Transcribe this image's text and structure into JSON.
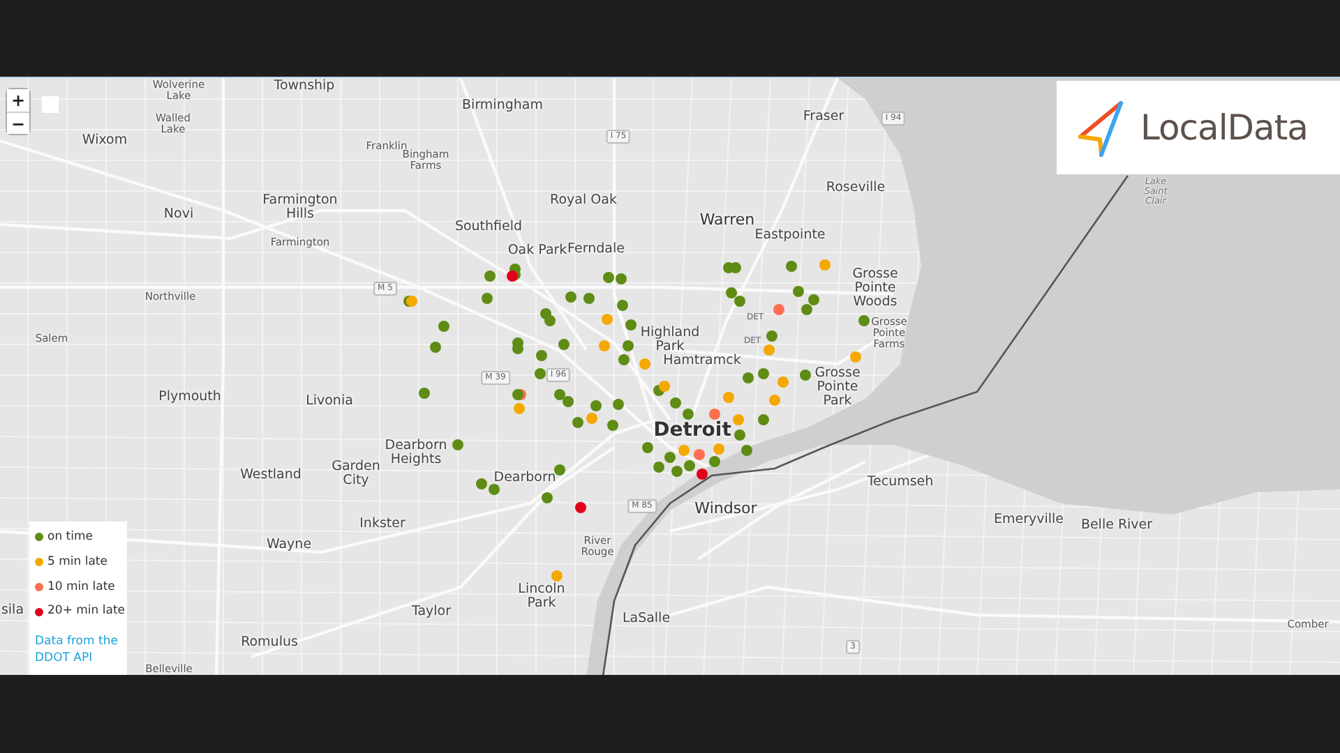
{
  "map_controls": {
    "zoom_in": "+",
    "zoom_out": "−"
  },
  "logo": {
    "text": "LocalData"
  },
  "place_labels": [
    {
      "text": "Township",
      "kind": "city"
    },
    {
      "text": "Wolverine Lake",
      "kind": "town"
    },
    {
      "text": "Walled Lake",
      "kind": "town"
    },
    {
      "text": "Wixom",
      "kind": "city"
    },
    {
      "text": "Birmingham",
      "kind": "city"
    },
    {
      "text": "Franklin",
      "kind": "town"
    },
    {
      "text": "Bingham Farms",
      "kind": "town"
    },
    {
      "text": "Novi",
      "kind": "city"
    },
    {
      "text": "Farmington Hills",
      "kind": "city"
    },
    {
      "text": "Farmington",
      "kind": "town"
    },
    {
      "text": "Royal Oak",
      "kind": "city"
    },
    {
      "text": "Southfield",
      "kind": "city"
    },
    {
      "text": "Oak Park",
      "kind": "city"
    },
    {
      "text": "Ferndale",
      "kind": "city"
    },
    {
      "text": "Northville",
      "kind": "town"
    },
    {
      "text": "Salem",
      "kind": "town"
    },
    {
      "text": "Highland Park",
      "kind": "city"
    },
    {
      "text": "Fraser",
      "kind": "city"
    },
    {
      "text": "Roseville",
      "kind": "city"
    },
    {
      "text": "Warren",
      "kind": "major"
    },
    {
      "text": "Eastpointe",
      "kind": "city"
    },
    {
      "text": "Grosse Pointe Woods",
      "kind": "city"
    },
    {
      "text": "Grosse Pointe Farms",
      "kind": "town"
    },
    {
      "text": "Hamtramck",
      "kind": "city"
    },
    {
      "text": "Grosse Pointe Park",
      "kind": "city"
    },
    {
      "text": "Detroit",
      "kind": "capital"
    },
    {
      "text": "Lake Saint Clair",
      "kind": "water"
    },
    {
      "text": "Plymouth",
      "kind": "city"
    },
    {
      "text": "Livonia",
      "kind": "city"
    },
    {
      "text": "Dearborn Heights",
      "kind": "city"
    },
    {
      "text": "Westland",
      "kind": "city"
    },
    {
      "text": "Garden City",
      "kind": "city"
    },
    {
      "text": "Dearborn",
      "kind": "city"
    },
    {
      "text": "Inkster",
      "kind": "city"
    },
    {
      "text": "Wayne",
      "kind": "city"
    },
    {
      "text": "River Rouge",
      "kind": "town"
    },
    {
      "text": "Lincoln Park",
      "kind": "city"
    },
    {
      "text": "Taylor",
      "kind": "city"
    },
    {
      "text": "LaSalle",
      "kind": "city"
    },
    {
      "text": "Romulus",
      "kind": "city"
    },
    {
      "text": "Belleville",
      "kind": "town"
    },
    {
      "text": "sila",
      "kind": "city"
    },
    {
      "text": "Windsor",
      "kind": "major"
    },
    {
      "text": "Tecumseh",
      "kind": "city"
    },
    {
      "text": "Emeryville",
      "kind": "city"
    },
    {
      "text": "Belle River",
      "kind": "city"
    },
    {
      "text": "Comber",
      "kind": "town"
    }
  ],
  "road_shields": [
    "M 5",
    "I 75",
    "I 94",
    "M 39",
    "I 96",
    "M 85",
    "3",
    "DET",
    "DET"
  ],
  "markers": [
    {
      "color": "#5e8c14"
    },
    {
      "color": "#5e8c14"
    },
    {
      "color": "#e3001b"
    },
    {
      "color": "#5e8c14"
    },
    {
      "color": "#5e8c14"
    },
    {
      "color": "#5e8c14"
    },
    {
      "color": "#f5a800"
    },
    {
      "color": "#5e8c14"
    },
    {
      "color": "#5e8c14"
    },
    {
      "color": "#5e8c14"
    },
    {
      "color": "#5e8c14"
    },
    {
      "color": "#5e8c14"
    },
    {
      "color": "#5e8c14"
    },
    {
      "color": "#5e8c14"
    },
    {
      "color": "#5e8c14"
    },
    {
      "color": "#5e8c14"
    },
    {
      "color": "#f5a800"
    },
    {
      "color": "#5e8c14"
    },
    {
      "color": "#5e8c14"
    },
    {
      "color": "#5e8c14"
    },
    {
      "color": "#5e8c14"
    },
    {
      "color": "#5e8c14"
    },
    {
      "color": "#f5a800"
    },
    {
      "color": "#f5a800"
    },
    {
      "color": "#5e8c14"
    },
    {
      "color": "#5e8c14"
    },
    {
      "color": "#ff6e4f"
    },
    {
      "color": "#f5a800"
    },
    {
      "color": "#5e8c14"
    },
    {
      "color": "#5e8c14"
    },
    {
      "color": "#5e8c14"
    },
    {
      "color": "#5e8c14"
    },
    {
      "color": "#f5a800"
    },
    {
      "color": "#5e8c14"
    },
    {
      "color": "#5e8c14"
    },
    {
      "color": "#5e8c14"
    },
    {
      "color": "#5e8c14"
    },
    {
      "color": "#5e8c14"
    },
    {
      "color": "#5e8c14"
    },
    {
      "color": "#5e8c14"
    },
    {
      "color": "#5e8c14"
    },
    {
      "color": "#5e8c14"
    },
    {
      "color": "#f5a800"
    },
    {
      "color": "#ff6e4f"
    },
    {
      "color": "#5e8c14"
    },
    {
      "color": "#e3001b"
    },
    {
      "color": "#5e8c14"
    },
    {
      "color": "#5e8c14"
    },
    {
      "color": "#5e8c14"
    },
    {
      "color": "#5e8c14"
    },
    {
      "color": "#5e8c14"
    },
    {
      "color": "#5e8c14"
    },
    {
      "color": "#e3001b"
    },
    {
      "color": "#f5a800"
    },
    {
      "color": "#5e8c14"
    },
    {
      "color": "#5e8c14"
    },
    {
      "color": "#5e8c14"
    },
    {
      "color": "#f5a800"
    },
    {
      "color": "#5e8c14"
    },
    {
      "color": "#5e8c14"
    },
    {
      "color": "#5e8c14"
    },
    {
      "color": "#5e8c14"
    },
    {
      "color": "#5e8c14"
    },
    {
      "color": "#ff6e4f"
    },
    {
      "color": "#5e8c14"
    },
    {
      "color": "#f5a800"
    },
    {
      "color": "#5e8c14"
    },
    {
      "color": "#f5a800"
    },
    {
      "color": "#5e8c14"
    },
    {
      "color": "#5e8c14"
    },
    {
      "color": "#5e8c14"
    },
    {
      "color": "#f5a800"
    },
    {
      "color": "#5e8c14"
    },
    {
      "color": "#f5a800"
    },
    {
      "color": "#f5a800"
    },
    {
      "color": "#ff6e4f"
    },
    {
      "color": "#f5a800"
    },
    {
      "color": "#5e8c14"
    },
    {
      "color": "#5e8c14"
    },
    {
      "color": "#f5a800"
    },
    {
      "color": "#5e8c14"
    },
    {
      "color": "#5e8c14"
    },
    {
      "color": "#5e8c14"
    },
    {
      "color": "#f5a800"
    }
  ],
  "legend": {
    "items": [
      {
        "label": "on time",
        "color": "#5e8c14"
      },
      {
        "label": "5 min late",
        "color": "#f5a800"
      },
      {
        "label": "10 min late",
        "color": "#ff6e4f"
      },
      {
        "label": "20+ min late",
        "color": "#e3001b"
      }
    ],
    "link": "Data from the DDOT API"
  }
}
